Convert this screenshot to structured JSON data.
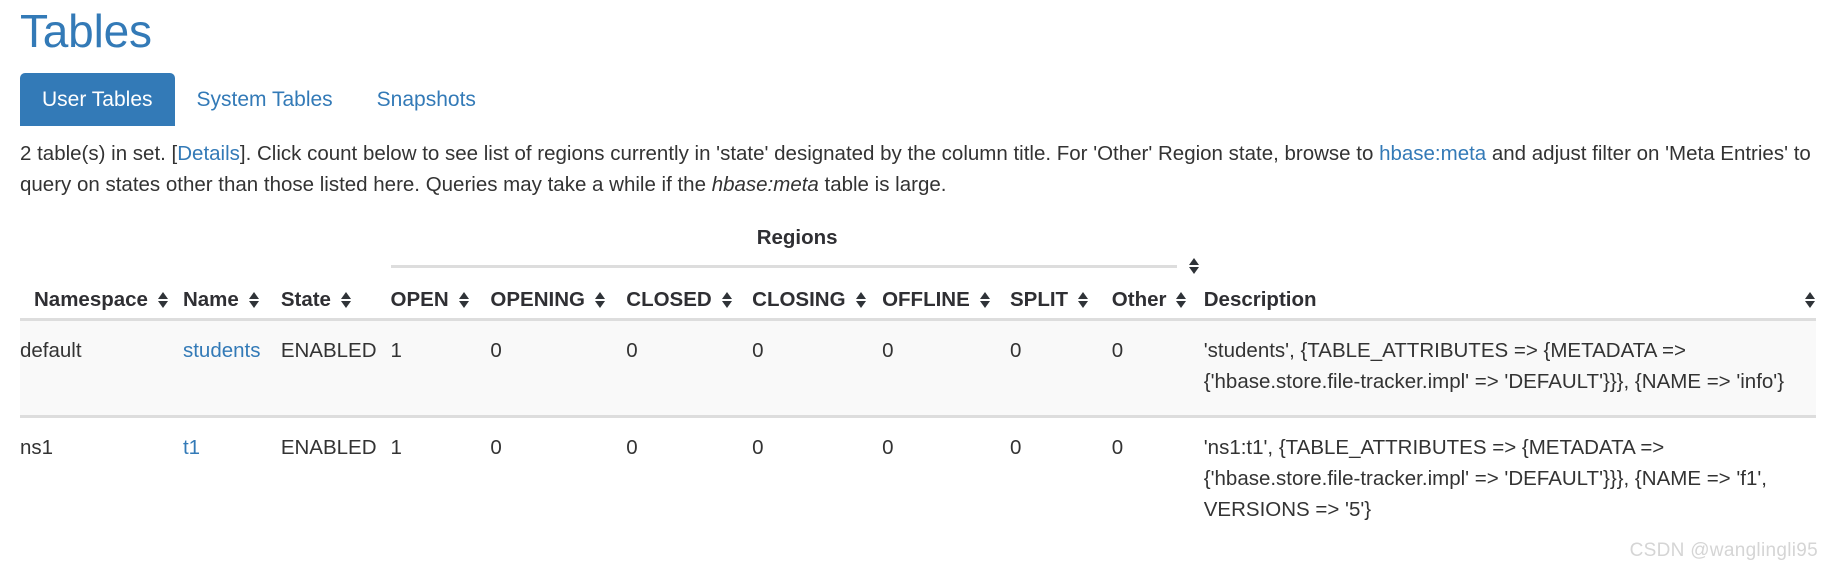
{
  "header": {
    "title": "Tables"
  },
  "tabs": [
    {
      "label": "User Tables",
      "active": true
    },
    {
      "label": "System Tables",
      "active": false
    },
    {
      "label": "Snapshots",
      "active": false
    }
  ],
  "intro": {
    "part1": "2 table(s) in set. [",
    "details_link": "Details",
    "part2": "]. Click count below to see list of regions currently in 'state' designated by the column title. For 'Other' Region state, browse to ",
    "meta_link": "hbase:meta",
    "part3": " and adjust filter on 'Meta Entries' to query on states other than those listed here. Queries may take a while if the ",
    "meta_em": "hbase:meta",
    "part4": " table is large."
  },
  "table": {
    "columns": {
      "namespace": "Namespace",
      "name": "Name",
      "state": "State",
      "description": "Description"
    },
    "group_header": "Regions",
    "region_columns": [
      "OPEN",
      "OPENING",
      "CLOSED",
      "CLOSING",
      "OFFLINE",
      "SPLIT",
      "Other"
    ],
    "rows": [
      {
        "namespace": "default",
        "name": "students",
        "state": "ENABLED",
        "open": "1",
        "opening": "0",
        "closed": "0",
        "closing": "0",
        "offline": "0",
        "split": "0",
        "other": "0",
        "description": "'students', {TABLE_ATTRIBUTES => {METADATA => {'hbase.store.file-tracker.impl' => 'DEFAULT'}}}, {NAME => 'info'}"
      },
      {
        "namespace": "ns1",
        "name": "t1",
        "state": "ENABLED",
        "open": "1",
        "opening": "0",
        "closed": "0",
        "closing": "0",
        "offline": "0",
        "split": "0",
        "other": "0",
        "description": "'ns1:t1', {TABLE_ATTRIBUTES => {METADATA => {'hbase.store.file-tracker.impl' => 'DEFAULT'}}}, {NAME => 'f1', VERSIONS => '5'}"
      }
    ]
  },
  "watermark": "CSDN @wanglingli95",
  "colors": {
    "link": "#337ab7",
    "tab_active_bg": "#337ab7",
    "row_stripe": "#f9f9f9",
    "border": "#dddddd"
  }
}
